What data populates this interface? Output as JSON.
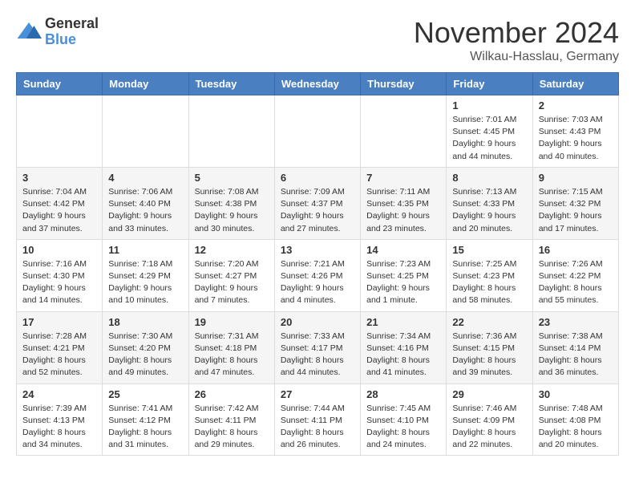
{
  "logo": {
    "general": "General",
    "blue": "Blue"
  },
  "header": {
    "month": "November 2024",
    "location": "Wilkau-Hasslau, Germany"
  },
  "weekdays": [
    "Sunday",
    "Monday",
    "Tuesday",
    "Wednesday",
    "Thursday",
    "Friday",
    "Saturday"
  ],
  "weeks": [
    [
      {
        "day": "",
        "info": ""
      },
      {
        "day": "",
        "info": ""
      },
      {
        "day": "",
        "info": ""
      },
      {
        "day": "",
        "info": ""
      },
      {
        "day": "",
        "info": ""
      },
      {
        "day": "1",
        "info": "Sunrise: 7:01 AM\nSunset: 4:45 PM\nDaylight: 9 hours\nand 44 minutes."
      },
      {
        "day": "2",
        "info": "Sunrise: 7:03 AM\nSunset: 4:43 PM\nDaylight: 9 hours\nand 40 minutes."
      }
    ],
    [
      {
        "day": "3",
        "info": "Sunrise: 7:04 AM\nSunset: 4:42 PM\nDaylight: 9 hours\nand 37 minutes."
      },
      {
        "day": "4",
        "info": "Sunrise: 7:06 AM\nSunset: 4:40 PM\nDaylight: 9 hours\nand 33 minutes."
      },
      {
        "day": "5",
        "info": "Sunrise: 7:08 AM\nSunset: 4:38 PM\nDaylight: 9 hours\nand 30 minutes."
      },
      {
        "day": "6",
        "info": "Sunrise: 7:09 AM\nSunset: 4:37 PM\nDaylight: 9 hours\nand 27 minutes."
      },
      {
        "day": "7",
        "info": "Sunrise: 7:11 AM\nSunset: 4:35 PM\nDaylight: 9 hours\nand 23 minutes."
      },
      {
        "day": "8",
        "info": "Sunrise: 7:13 AM\nSunset: 4:33 PM\nDaylight: 9 hours\nand 20 minutes."
      },
      {
        "day": "9",
        "info": "Sunrise: 7:15 AM\nSunset: 4:32 PM\nDaylight: 9 hours\nand 17 minutes."
      }
    ],
    [
      {
        "day": "10",
        "info": "Sunrise: 7:16 AM\nSunset: 4:30 PM\nDaylight: 9 hours\nand 14 minutes."
      },
      {
        "day": "11",
        "info": "Sunrise: 7:18 AM\nSunset: 4:29 PM\nDaylight: 9 hours\nand 10 minutes."
      },
      {
        "day": "12",
        "info": "Sunrise: 7:20 AM\nSunset: 4:27 PM\nDaylight: 9 hours\nand 7 minutes."
      },
      {
        "day": "13",
        "info": "Sunrise: 7:21 AM\nSunset: 4:26 PM\nDaylight: 9 hours\nand 4 minutes."
      },
      {
        "day": "14",
        "info": "Sunrise: 7:23 AM\nSunset: 4:25 PM\nDaylight: 9 hours\nand 1 minute."
      },
      {
        "day": "15",
        "info": "Sunrise: 7:25 AM\nSunset: 4:23 PM\nDaylight: 8 hours\nand 58 minutes."
      },
      {
        "day": "16",
        "info": "Sunrise: 7:26 AM\nSunset: 4:22 PM\nDaylight: 8 hours\nand 55 minutes."
      }
    ],
    [
      {
        "day": "17",
        "info": "Sunrise: 7:28 AM\nSunset: 4:21 PM\nDaylight: 8 hours\nand 52 minutes."
      },
      {
        "day": "18",
        "info": "Sunrise: 7:30 AM\nSunset: 4:20 PM\nDaylight: 8 hours\nand 49 minutes."
      },
      {
        "day": "19",
        "info": "Sunrise: 7:31 AM\nSunset: 4:18 PM\nDaylight: 8 hours\nand 47 minutes."
      },
      {
        "day": "20",
        "info": "Sunrise: 7:33 AM\nSunset: 4:17 PM\nDaylight: 8 hours\nand 44 minutes."
      },
      {
        "day": "21",
        "info": "Sunrise: 7:34 AM\nSunset: 4:16 PM\nDaylight: 8 hours\nand 41 minutes."
      },
      {
        "day": "22",
        "info": "Sunrise: 7:36 AM\nSunset: 4:15 PM\nDaylight: 8 hours\nand 39 minutes."
      },
      {
        "day": "23",
        "info": "Sunrise: 7:38 AM\nSunset: 4:14 PM\nDaylight: 8 hours\nand 36 minutes."
      }
    ],
    [
      {
        "day": "24",
        "info": "Sunrise: 7:39 AM\nSunset: 4:13 PM\nDaylight: 8 hours\nand 34 minutes."
      },
      {
        "day": "25",
        "info": "Sunrise: 7:41 AM\nSunset: 4:12 PM\nDaylight: 8 hours\nand 31 minutes."
      },
      {
        "day": "26",
        "info": "Sunrise: 7:42 AM\nSunset: 4:11 PM\nDaylight: 8 hours\nand 29 minutes."
      },
      {
        "day": "27",
        "info": "Sunrise: 7:44 AM\nSunset: 4:11 PM\nDaylight: 8 hours\nand 26 minutes."
      },
      {
        "day": "28",
        "info": "Sunrise: 7:45 AM\nSunset: 4:10 PM\nDaylight: 8 hours\nand 24 minutes."
      },
      {
        "day": "29",
        "info": "Sunrise: 7:46 AM\nSunset: 4:09 PM\nDaylight: 8 hours\nand 22 minutes."
      },
      {
        "day": "30",
        "info": "Sunrise: 7:48 AM\nSunset: 4:08 PM\nDaylight: 8 hours\nand 20 minutes."
      }
    ]
  ]
}
